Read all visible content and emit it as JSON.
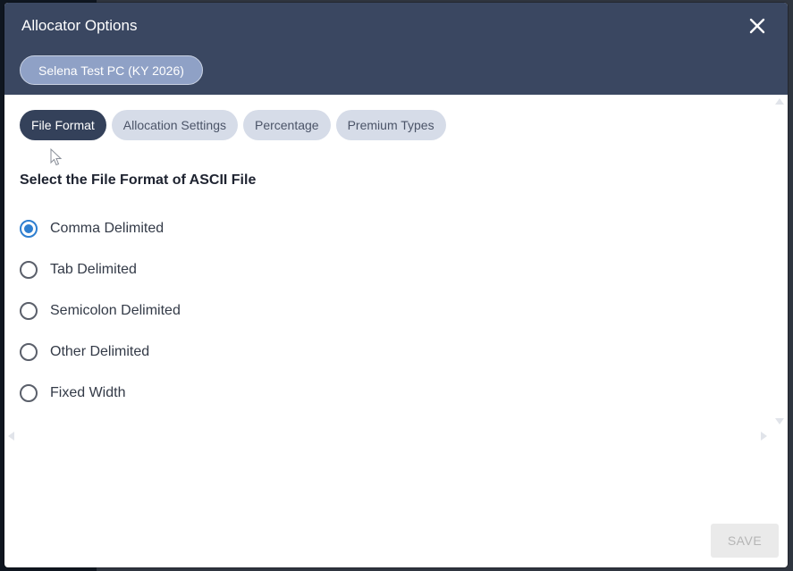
{
  "dialog": {
    "title": "Allocator Options",
    "close_icon": "close-icon",
    "entity_label": "Selena Test PC (KY 2026)"
  },
  "tabs": [
    {
      "label": "File Format",
      "active": true
    },
    {
      "label": "Allocation Settings",
      "active": false
    },
    {
      "label": "Percentage",
      "active": false
    },
    {
      "label": "Premium Types",
      "active": false
    }
  ],
  "file_format": {
    "heading": "Select the File Format of ASCII File",
    "options": [
      {
        "label": "Comma Delimited",
        "checked": true
      },
      {
        "label": "Tab Delimited",
        "checked": false
      },
      {
        "label": "Semicolon Delimited",
        "checked": false
      },
      {
        "label": "Other Delimited",
        "checked": false
      },
      {
        "label": "Fixed Width",
        "checked": false
      }
    ]
  },
  "footer": {
    "save_label": "SAVE",
    "save_disabled": true
  },
  "colors": {
    "header_bg": "#3a4761",
    "active_tab": "#34415a",
    "inactive_tab": "#d6dce8",
    "radio_checked": "#2f7fd0"
  }
}
